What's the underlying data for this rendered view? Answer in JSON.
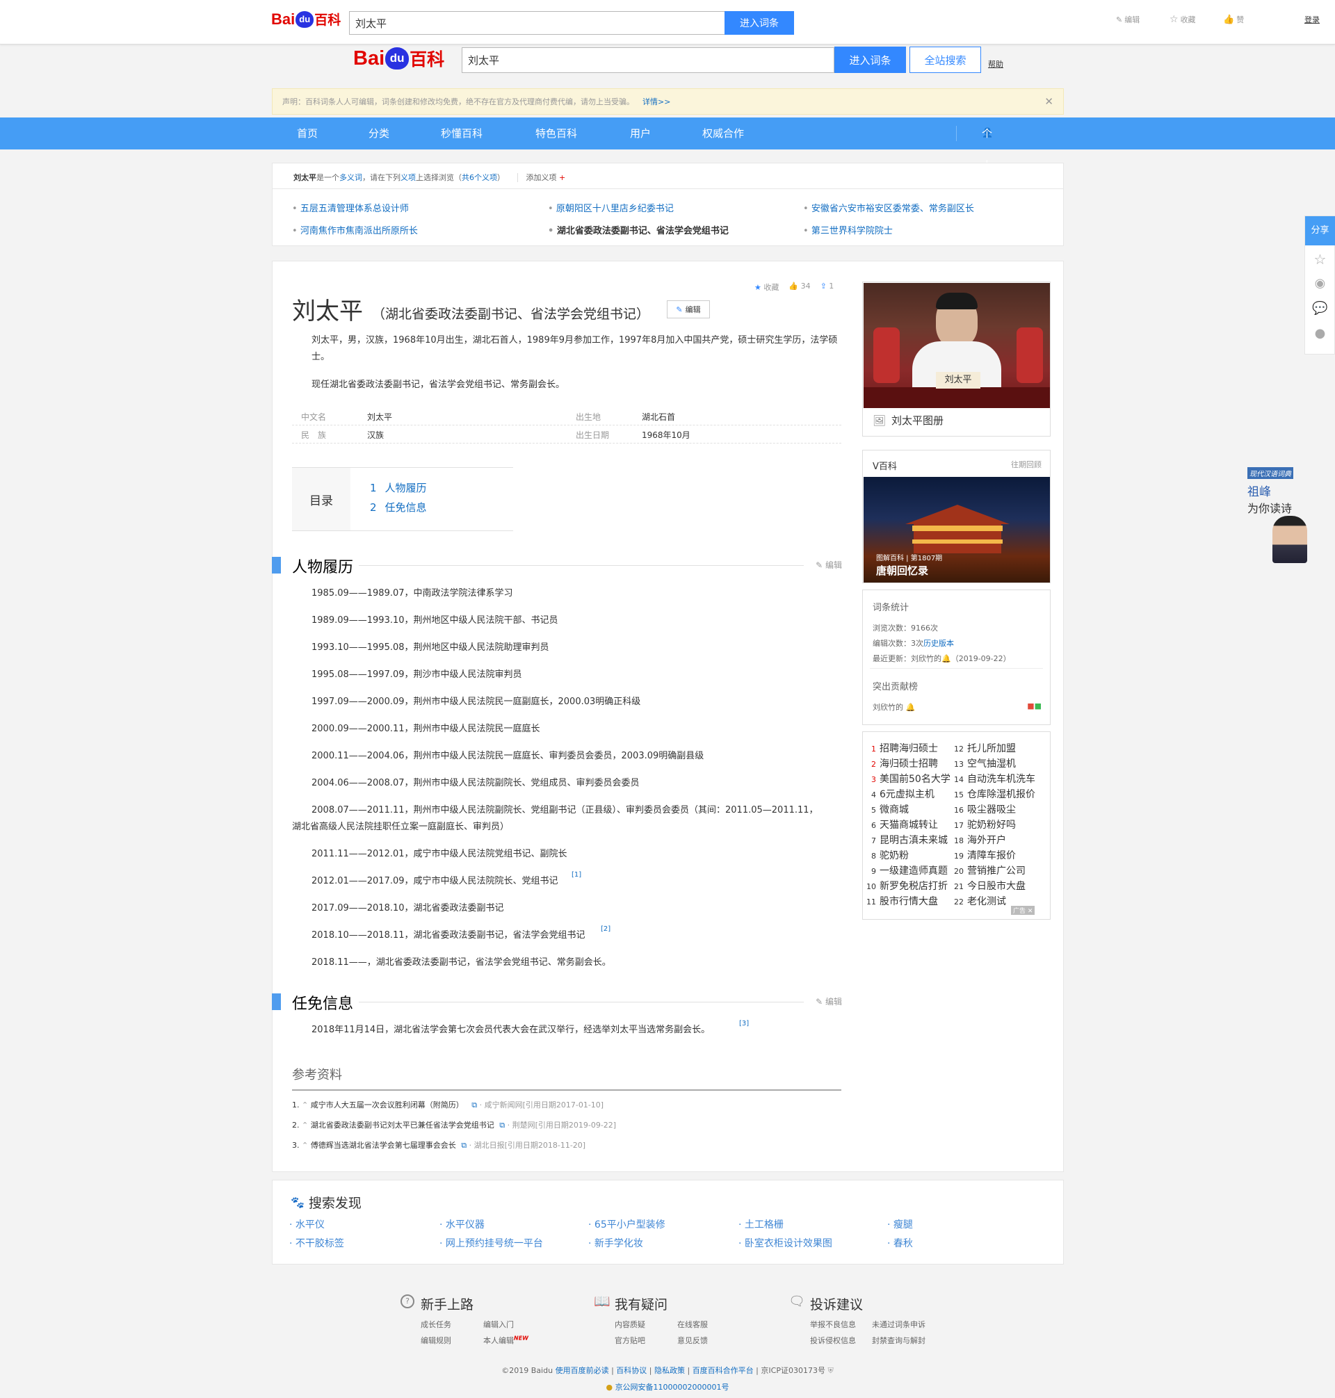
{
  "header": {
    "logo_bai": "Bai",
    "logo_du": "du",
    "logo_bk": "百科",
    "search_value": "刘太平",
    "enter_btn": "进入词条",
    "actions": [
      "编辑",
      "收藏",
      "赞"
    ],
    "login": "登录"
  },
  "header2": {
    "search_value": "刘太平",
    "enter_btn": "进入词条",
    "site_btn": "全站搜索",
    "help": "帮助"
  },
  "notice": {
    "text": "声明：百科词条人人可编辑，词条创建和修改均免费，绝不存在官方及代理商付费代编，请勿上当受骗。",
    "link": "详情>>"
  },
  "nav": {
    "items": [
      "首页",
      "分类",
      "秒懂百科",
      "特色百科",
      "用户",
      "权威合作"
    ],
    "personal": "个人中心"
  },
  "poly": {
    "name": "刘太平",
    "p1": "是一个",
    "p2": "多义词",
    "p3": "，请在下列",
    "p4": "义项",
    "p5": "上选择浏览（",
    "p6": "共6个义项",
    "p7": "）",
    "add": "添加义项",
    "items": [
      "五层五清管理体系总设计师",
      "原朝阳区十八里店乡纪委书记",
      "安徽省六安市裕安区委常委、常务副区长",
      "河南焦作市焦南派出所原所长",
      "湖北省委政法委副书记、省法学会党组书记",
      "第三世界科学院院士"
    ]
  },
  "article": {
    "title": "刘太平",
    "subtitle": "（湖北省委政法委副书记、省法学会党组书记）",
    "edit": "编辑",
    "fav": "收藏",
    "likes": "34",
    "shares": "1",
    "summary1": "刘太平，男，汉族，1968年10月出生，湖北石首人，1989年9月参加工作，1997年8月加入中国共产党，硕士研究生学历，法学硕士。",
    "summary2": "现任湖北省委政法委副书记，省法学会党组书记、常务副会长。",
    "basic": [
      {
        "k": "中文名",
        "v": "刘太平"
      },
      {
        "k": "出生地",
        "v": "湖北石首"
      },
      {
        "k": "民　族",
        "v": "汉族"
      },
      {
        "k": "出生日期",
        "v": "1968年10月"
      }
    ],
    "toc_title": "目录",
    "toc": [
      {
        "n": "1",
        "t": "人物履历"
      },
      {
        "n": "2",
        "t": "任免信息"
      }
    ],
    "sec1": "人物履历",
    "sec2": "任免信息",
    "sec_edit": "编辑",
    "resume": [
      "1985.09——1989.07，中南政法学院法律系学习",
      "1989.09——1993.10，荆州地区中级人民法院干部、书记员",
      "1993.10——1995.08，荆州地区中级人民法院助理审判员",
      "1995.08——1997.09，荆沙市中级人民法院审判员",
      "1997.09——2000.09，荆州市中级人民法院民一庭副庭长，2000.03明确正科级",
      "2000.09——2000.11，荆州市中级人民法院民一庭庭长",
      "2000.11——2004.06，荆州市中级人民法院民一庭庭长、审判委员会委员，2003.09明确副县级",
      "2004.06——2008.07，荆州市中级人民法院副院长、党组成员、审判委员会委员",
      "2008.07——2011.11，荆州市中级人民法院副院长、党组副书记（正县级）、审判委员会委员（其间：2011.05—2011.11，",
      "湖北省高级人民法院挂职任立案一庭副庭长、审判员）",
      "2011.11——2012.01，咸宁市中级人民法院党组书记、副院长",
      "2012.01——2017.09，咸宁市中级人民法院院长、党组书记",
      "2017.09——2018.10，湖北省委政法委副书记",
      "2018.10——2018.11，湖北省委政法委副书记，省法学会党组书记",
      "2018.11——，湖北省委政法委副书记，省法学会党组书记、常务副会长。"
    ],
    "sup1": "[1]",
    "sup2": "[2]",
    "sup3": "[3]",
    "appoint": "2018年11月14日，湖北省法学会第七次会员代表大会在武汉举行，经选举刘太平当选常务副会长。",
    "ref_title": "参考资料",
    "refs": [
      {
        "n": "1.",
        "t": "咸宁市人大五届一次会议胜利闭幕（附简历）",
        "s": "咸宁新闻网[引用日期2017-01-10]"
      },
      {
        "n": "2.",
        "t": "湖北省委政法委副书记刘太平已兼任省法学会党组书记",
        "s": "荆楚网[引用日期2019-09-22]"
      },
      {
        "n": "3.",
        "t": "傅德辉当选湖北省法学会第七届理事会会长",
        "s": "湖北日报[引用日期2018-11-20]"
      }
    ]
  },
  "side": {
    "album": "刘太平图册",
    "nameplate": "刘太平",
    "vbk": "V百科",
    "past": "往期回顾",
    "video_tag": "图解百科 | 第1807期",
    "video_title": "唐朝回忆录",
    "stats_title": "词条统计",
    "views": "浏览次数：9166次",
    "edits_pre": "编辑次数：3次",
    "edits_link": "历史版本",
    "updated_pre": "最近更新：",
    "updated_user": "刘欣竹的",
    "updated_date": "（2019-09-22）",
    "contrib_title": "突出贡献榜",
    "contrib_user": "刘欣竹的",
    "rank_left": [
      {
        "n": "1",
        "t": "招聘海归硕士"
      },
      {
        "n": "2",
        "t": "海归硕士招聘"
      },
      {
        "n": "3",
        "t": "美国前50名大学"
      },
      {
        "n": "4",
        "t": "6元虚拟主机"
      },
      {
        "n": "5",
        "t": "微商城"
      },
      {
        "n": "6",
        "t": "天猫商城转让"
      },
      {
        "n": "7",
        "t": "昆明古滇未来城"
      },
      {
        "n": "8",
        "t": "驼奶粉"
      },
      {
        "n": "9",
        "t": "一级建造师真题"
      },
      {
        "n": "10",
        "t": "新罗免税店打折"
      },
      {
        "n": "11",
        "t": "股市行情大盘"
      }
    ],
    "rank_right": [
      {
        "n": "12",
        "t": "托儿所加盟"
      },
      {
        "n": "13",
        "t": "空气抽湿机"
      },
      {
        "n": "14",
        "t": "自动洗车机洗车"
      },
      {
        "n": "15",
        "t": "仓库除湿机报价"
      },
      {
        "n": "16",
        "t": "吸尘器吸尘"
      },
      {
        "n": "17",
        "t": "驼奶粉好吗"
      },
      {
        "n": "18",
        "t": "海外开户"
      },
      {
        "n": "19",
        "t": "清障车报价"
      },
      {
        "n": "20",
        "t": "营销推广公司"
      },
      {
        "n": "21",
        "t": "今日股市大盘"
      },
      {
        "n": "22",
        "t": "老化测试"
      }
    ],
    "ad": "广告"
  },
  "share": {
    "label": "分享"
  },
  "float_ad": {
    "brand": "现代汉语词典",
    "name": "祖峰",
    "sub": "为你读诗"
  },
  "discover": {
    "title": "搜索发现",
    "items": [
      "水平仪",
      "水平仪器",
      "65平小户型装修",
      "土工格栅",
      "瘦腿",
      "不干胶标签",
      "网上预约挂号统一平台",
      "新手学化妆",
      "卧室衣柜设计效果图",
      "春秋"
    ]
  },
  "footer": {
    "c1": {
      "title": "新手上路",
      "links": [
        "成长任务",
        "编辑入门",
        "编辑规则",
        "本人编辑"
      ],
      "new": "NEW"
    },
    "c2": {
      "title": "我有疑问",
      "links": [
        "内容质疑",
        "在线客服",
        "官方贴吧",
        "意见反馈"
      ]
    },
    "c3": {
      "title": "投诉建议",
      "links": [
        "举报不良信息",
        "未通过词条申诉",
        "投诉侵权信息",
        "封禁查询与解封"
      ]
    },
    "copy": "©2019 Baidu",
    "l1": "使用百度前必读",
    "l2": "百科协议",
    "l3": "隐私政策",
    "l4": "百度百科合作平台",
    "icp": "京ICP证030173号",
    "police": "京公网安备11000002000001号"
  },
  "colors": {
    "accent": "#3388ff",
    "nav": "#459df5",
    "brand_red": "#e10601",
    "link": "#136ec2"
  }
}
